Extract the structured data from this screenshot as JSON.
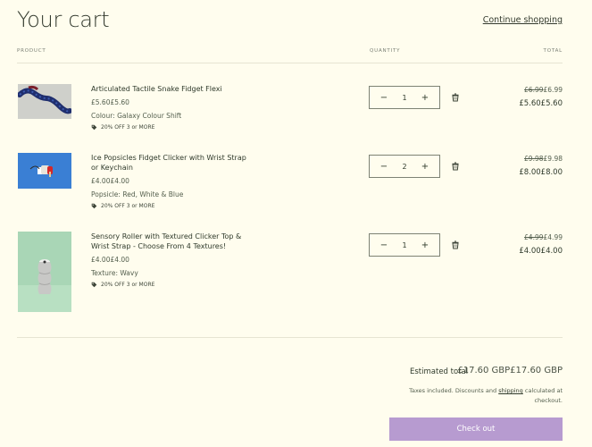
{
  "header": {
    "title": "Your cart",
    "continue_label": "Continue shopping"
  },
  "columns": {
    "product": "PRODUCT",
    "quantity": "QUANTITY",
    "total": "TOTAL"
  },
  "items": [
    {
      "name": "Articulated Tactile Snake Fidget Flexi",
      "price": "£5.60£5.60",
      "variant": "Colour: Galaxy Colour Shift",
      "discount": "20% OFF 3 or MORE",
      "quantity": "1",
      "original_total": "£6.99",
      "original_total_plain": "£6.99",
      "final_total": "£5.60£5.60"
    },
    {
      "name": "Ice Popsicles Fidget Clicker with Wrist Strap or Keychain",
      "price": "£4.00£4.00",
      "variant": "Popsicle: Red, White & Blue",
      "discount": "20% OFF 3 or MORE",
      "quantity": "2",
      "original_total": "£9.98",
      "original_total_plain": "£9.98",
      "final_total": "£8.00£8.00"
    },
    {
      "name": "Sensory Roller with Textured Clicker Top & Wrist Strap - Choose From 4 Textures!",
      "price": "£4.00£4.00",
      "variant": "Texture: Wavy",
      "discount": "20% OFF 3 or MORE",
      "quantity": "1",
      "original_total": "£4.99",
      "original_total_plain": "£4.99",
      "final_total": "£4.00£4.00"
    }
  ],
  "qty_controls": {
    "minus": "−",
    "plus": "+"
  },
  "summary": {
    "estimated_label": "Estimated total",
    "estimated_value": "£17.60 GBP£17.60 GBP",
    "tax_before": "Taxes included. Discounts and ",
    "tax_link": "shipping",
    "tax_after": " calculated at checkout.",
    "checkout_label": "Check out"
  },
  "colors": {
    "background": "#fffdee",
    "checkout_button": "#b79bd0",
    "text": "#2f3a2b"
  }
}
